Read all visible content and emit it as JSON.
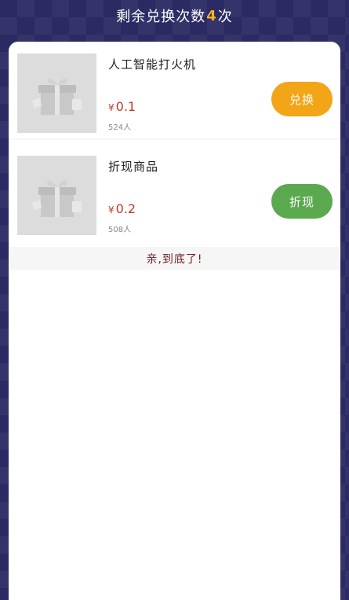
{
  "header": {
    "prefix": "剩余兑换次数",
    "count": "4",
    "suffix": "次"
  },
  "items": [
    {
      "name": "人工智能打火机",
      "currency": "¥",
      "price": "0.1",
      "people": "524人",
      "button_label": "兑换",
      "button_color": "#f2a516"
    },
    {
      "name": "折现商品",
      "currency": "¥",
      "price": "0.2",
      "people": "508人",
      "button_label": "折现",
      "button_color": "#5ba94e"
    }
  ],
  "footer": {
    "text": "亲,到底了!"
  },
  "colors": {
    "background": "#2b2a63",
    "price": "#c0392b",
    "count": "#f5b322"
  },
  "icons": {
    "thumb": "gift-box-icon"
  }
}
